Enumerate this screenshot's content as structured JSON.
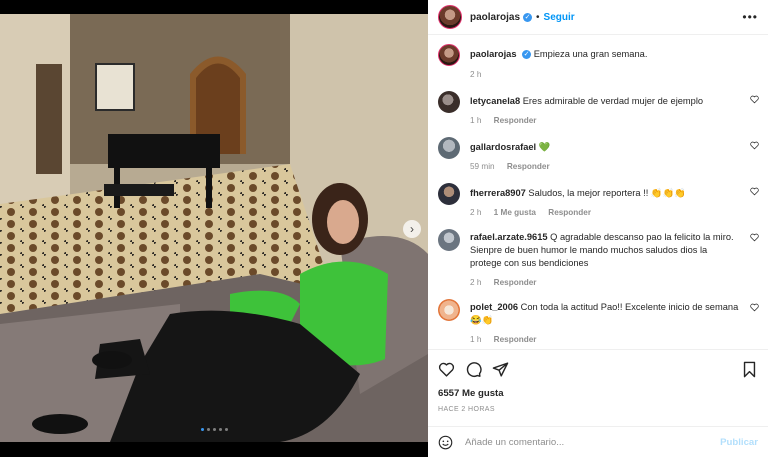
{
  "post": {
    "username": "paolarojas",
    "follow_label": "Seguir",
    "caption_user": "paolarojas",
    "caption_text": "Empieza una gran semana.",
    "caption_time": "2 h"
  },
  "comments": [
    {
      "user": "letycanela8",
      "text": "Eres admirable de verdad mujer de ejemplo",
      "time": "1 h",
      "reply": "Responder"
    },
    {
      "user": "gallardosrafael",
      "text": "💚",
      "time": "59 min",
      "reply": "Responder"
    },
    {
      "user": "fherrera8907",
      "text": "Saludos, la mejor reportera !! 👏👏👏",
      "time": "2 h",
      "likes": "1 Me gusta",
      "reply": "Responder"
    },
    {
      "user": "rafael.arzate.9615",
      "text": "Q agradable descanso pao la felicito la miro. Sienpre de buen humor le mando muchos saludos dios la protege con sus bendiciones",
      "time": "2 h",
      "reply": "Responder"
    },
    {
      "user": "polet_2006",
      "text": "Con toda la actitud Pao!! Excelente inicio de semana 😂👏",
      "time": "1 h",
      "reply": "Responder"
    }
  ],
  "actions": {
    "likes": "6557 Me gusta",
    "ago": "HACE 2 HORAS"
  },
  "add_comment": {
    "placeholder": "Añade un comentario...",
    "post_label": "Publicar"
  },
  "carousel": {
    "slides": 5,
    "active": 0
  },
  "colors": {
    "accent": "#0095f6",
    "verified": "#3897f0",
    "muted": "#8e8e8e",
    "sweater": "#3ec23a"
  }
}
